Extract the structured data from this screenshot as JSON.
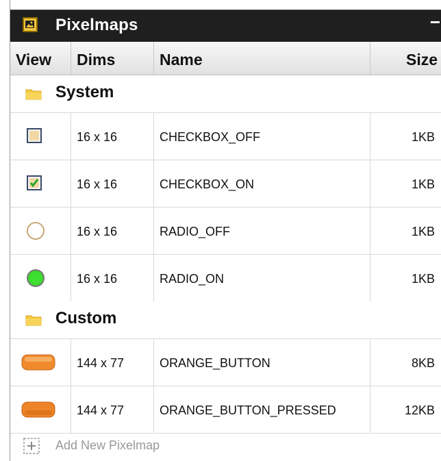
{
  "panel": {
    "title": "Pixelmaps",
    "minimize": "−"
  },
  "columns": {
    "view": "View",
    "dims": "Dims",
    "name": "Name",
    "size": "Size"
  },
  "groups": [
    {
      "label": "System",
      "rows": [
        {
          "icon": "checkbox-off-icon",
          "dims": "16 x 16",
          "name": "CHECKBOX_OFF",
          "size": "1KB"
        },
        {
          "icon": "checkbox-on-icon",
          "dims": "16 x 16",
          "name": "CHECKBOX_ON",
          "size": "1KB"
        },
        {
          "icon": "radio-off-icon",
          "dims": "16 x 16",
          "name": "RADIO_OFF",
          "size": "1KB"
        },
        {
          "icon": "radio-on-icon",
          "dims": "16 x 16",
          "name": "RADIO_ON",
          "size": "1KB"
        }
      ]
    },
    {
      "label": "Custom",
      "rows": [
        {
          "icon": "orange-button-icon",
          "dims": "144 x 77",
          "name": "ORANGE_BUTTON",
          "size": "8KB"
        },
        {
          "icon": "orange-button-pressed-icon",
          "dims": "144 x 77",
          "name": "ORANGE_BUTTON_PRESSED",
          "size": "12KB"
        }
      ]
    }
  ],
  "add": {
    "label": "Add New Pixelmap"
  },
  "colors": {
    "titlebar": "#1f1f1f",
    "folder": "#f5c842",
    "orange": "#f08a2c",
    "green": "#39d72b"
  }
}
